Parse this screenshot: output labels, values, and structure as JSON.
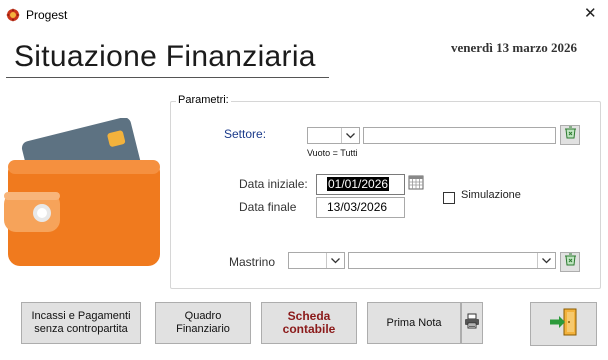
{
  "window": {
    "title": "Progest",
    "close_glyph": "✕"
  },
  "header": {
    "title": "Situazione Finanziaria",
    "date": "venerdì 13 marzo 2026"
  },
  "params": {
    "legend": "Parametri:",
    "settore_label": "Settore:",
    "settore_hint": "Vuoto = Tutti",
    "data_iniziale_label": "Data iniziale:",
    "data_iniziale_value": "01/01/2026",
    "data_finale_label": "Data finale",
    "data_finale_value": "13/03/2026",
    "simulazione_label": "Simulazione",
    "simulazione_checked": false,
    "mastrino_label": "Mastrino"
  },
  "buttons": {
    "incassi_line1": "Incassi e Pagamenti",
    "incassi_line2": "senza contropartita",
    "quadro_line1": "Quadro",
    "quadro_line2": "Finanziario",
    "scheda_line1": "Scheda",
    "scheda_line2": "contabile",
    "prima_nota": "Prima Nota"
  },
  "icons": {
    "app": "app-logo-icon",
    "calendar": "calendar-icon",
    "clear": "clear-filter-icon",
    "print": "printer-icon",
    "exit": "exit-door-icon",
    "wallet": "wallet-illustration"
  },
  "colors": {
    "wallet_orange": "#f07a1e",
    "label_blue": "#1a3a8a",
    "scheda_red": "#8b1a1a"
  }
}
